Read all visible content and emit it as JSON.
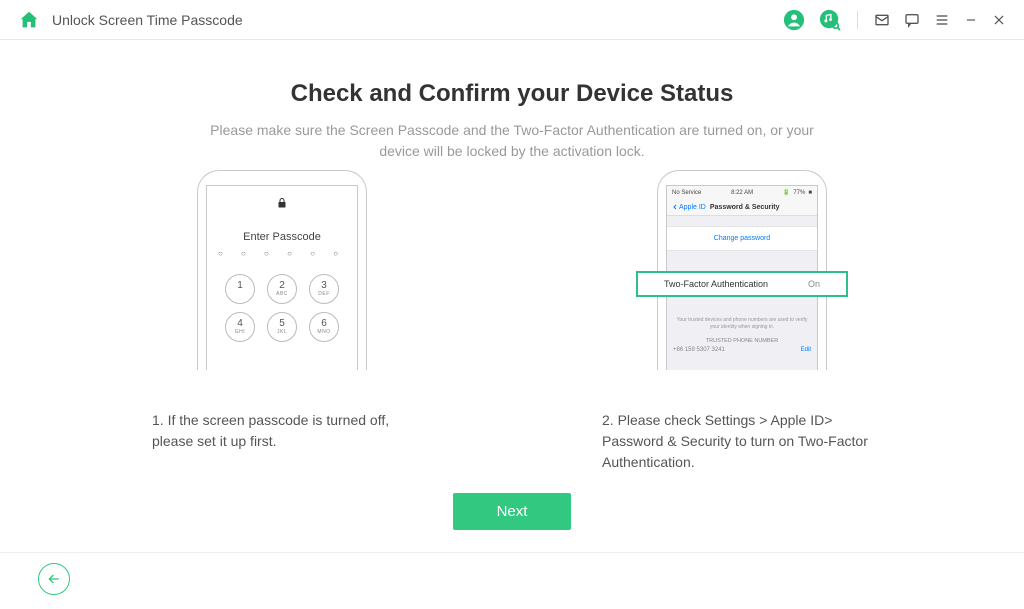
{
  "header": {
    "title": "Unlock Screen Time Passcode"
  },
  "main": {
    "title": "Check and Confirm your Device Status",
    "subtitle": "Please make sure the Screen Passcode and the Two-Factor Authentication are turned on, or your device will be locked by the activation lock."
  },
  "phone1": {
    "passcode_label": "Enter Passcode",
    "keys": {
      "k1": "1",
      "k2": "2",
      "k2s": "ABC",
      "k3": "3",
      "k3s": "DEF",
      "k4": "4",
      "k4s": "GHI",
      "k5": "5",
      "k5s": "JKL",
      "k6": "6",
      "k6s": "MNO"
    }
  },
  "phone2": {
    "status_left": "No Service",
    "status_time": "8:22 AM",
    "status_batt": "77%",
    "back_label": "Apple ID",
    "nav_title": "Password & Security",
    "change_password": "Change password",
    "tfa_label": "Two-Factor Authentication",
    "tfa_value": "On",
    "tfa_desc": "Your trusted devices and phone numbers are used to verify your identity when signing in.",
    "trusted_label": "TRUSTED PHONE NUMBER",
    "trusted_edit": "Edit",
    "trusted_num": "+86 159 5307 3241"
  },
  "captions": {
    "c1": "1. If the screen passcode is turned off, please set it up first.",
    "c2": "2. Please check Settings > Apple ID> Password & Security to turn on Two-Factor Authentication."
  },
  "buttons": {
    "next": "Next"
  }
}
